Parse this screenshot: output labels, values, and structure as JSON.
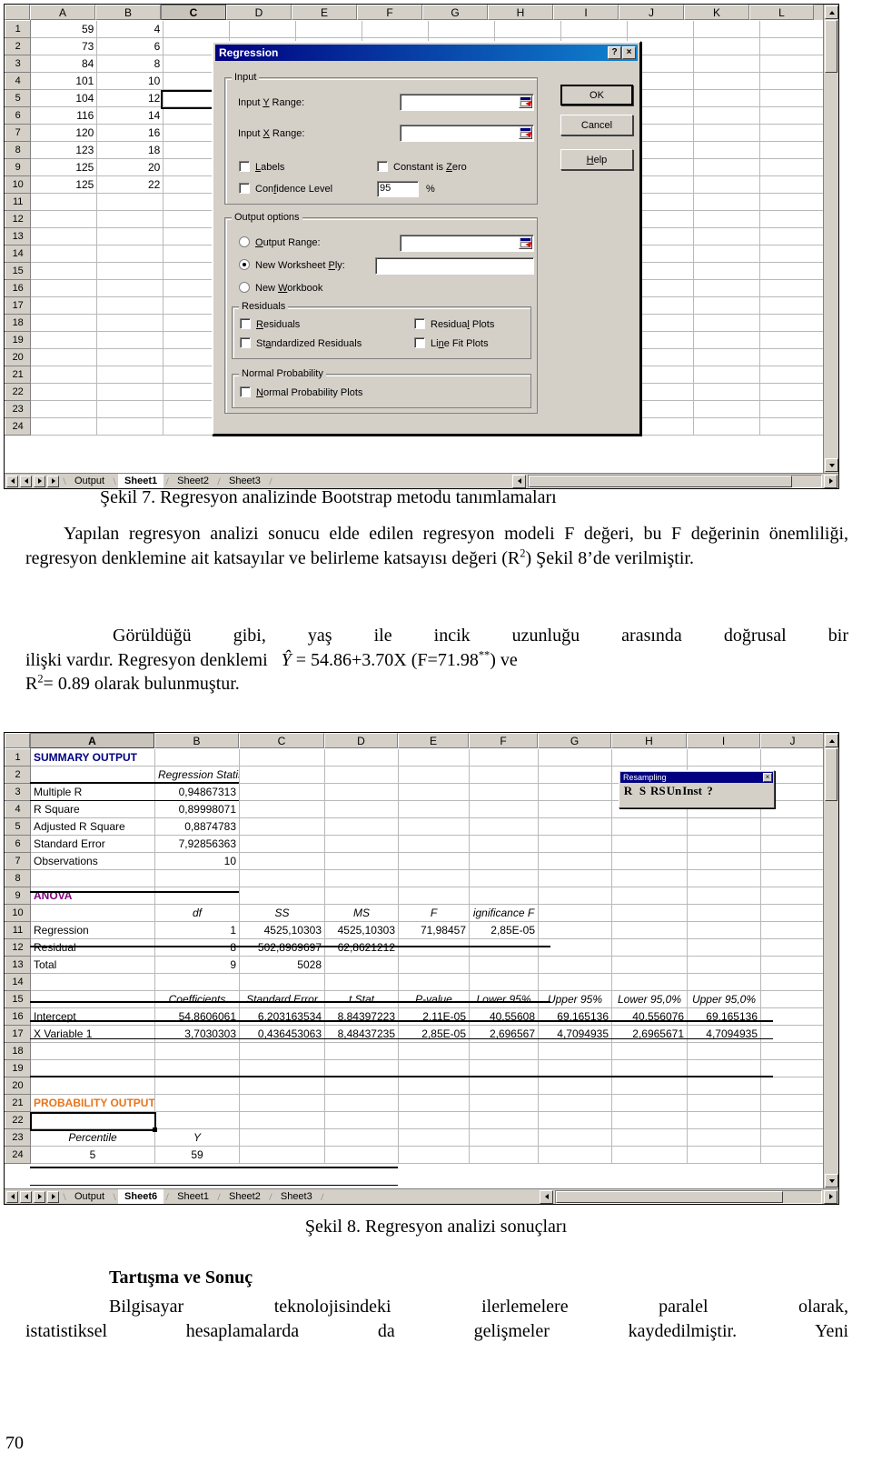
{
  "figure7": {
    "columns": [
      "A",
      "B",
      "C",
      "D",
      "E",
      "F",
      "G",
      "H",
      "I",
      "J",
      "K",
      "L"
    ],
    "selected_column": "C",
    "selected_cell_row": 5,
    "rows": [
      "1",
      "2",
      "3",
      "4",
      "5",
      "6",
      "7",
      "8",
      "9",
      "10",
      "11",
      "12",
      "13",
      "14",
      "15",
      "16",
      "17",
      "18",
      "19",
      "20",
      "21",
      "22",
      "23",
      "24"
    ],
    "data": [
      {
        "row": "1",
        "a": "59",
        "b": "4"
      },
      {
        "row": "2",
        "a": "73",
        "b": "6"
      },
      {
        "row": "3",
        "a": "84",
        "b": "8"
      },
      {
        "row": "4",
        "a": "101",
        "b": "10"
      },
      {
        "row": "5",
        "a": "104",
        "b": "12"
      },
      {
        "row": "6",
        "a": "116",
        "b": "14"
      },
      {
        "row": "7",
        "a": "120",
        "b": "16"
      },
      {
        "row": "8",
        "a": "123",
        "b": "18"
      },
      {
        "row": "9",
        "a": "125",
        "b": "20"
      },
      {
        "row": "10",
        "a": "125",
        "b": "22"
      }
    ],
    "tabs": [
      {
        "label": "Output",
        "active": false
      },
      {
        "label": "Sheet1",
        "active": true
      },
      {
        "label": "Sheet2",
        "active": false
      },
      {
        "label": "Sheet3",
        "active": false
      }
    ]
  },
  "dialog": {
    "title": "Regression",
    "help_button": "?",
    "close_button": "×",
    "input_group": "Input",
    "input_y_label": "Input Y Range:",
    "input_y_value": "",
    "input_x_label": "Input X Range:",
    "input_x_value": "",
    "labels_checkbox": "Labels",
    "constant_is_zero_checkbox": "Constant is Zero",
    "confidence_level_checkbox": "Confidence Level",
    "confidence_level_value": "95",
    "percent_sign": "%",
    "output_group": "Output options",
    "output_range_radio": "Output Range:",
    "output_range_value": "",
    "new_worksheet_ply_radio": "New Worksheet Ply:",
    "new_worksheet_ply_value": "",
    "new_workbook_radio": "New Workbook",
    "residuals_group": "Residuals",
    "residuals_checkbox": "Residuals",
    "residual_plots_checkbox": "Residual Plots",
    "standardized_residuals_checkbox": "Standardized Residuals",
    "line_fit_plots_checkbox": "Line Fit Plots",
    "normal_probability_group": "Normal Probability",
    "normal_probability_plots_checkbox": "Normal Probability Plots",
    "ok_button": "OK",
    "cancel_button": "Cancel",
    "help_label": "Help",
    "selected_output_option": "New Worksheet Ply:"
  },
  "caption7": "Şekil 7. Regresyon analizinde Bootstrap metodu tanımlamaları",
  "body_paragraph_1": "Yapılan regresyon analizi sonucu elde edilen regresyon modeli F değeri, bu F değerinin önemliliği, regresyon denklemine ait katsayılar ve belirleme katsayısı değeri (R",
  "body_paragraph_1_sup": "2",
  "body_paragraph_1_cont": ") Şekil 8’de verilmiştir.",
  "body_paragraph_2_a": "Görüldüğü gibi, yaş ile incik uzunluğu arasında doğrusal bir",
  "body_paragraph_2_b_pre": "ilişki vardır. Regresyon denklemi",
  "equation_yhat": "Ŷ",
  "equation_body": "= 54.86+3.70X   (F=71.98",
  "equation_sup": "**",
  "equation_tail": ") ve",
  "body_paragraph_2_c_pre": "R",
  "body_paragraph_2_c_sup": "2",
  "body_paragraph_2_c_post": "= 0.89 olarak bulunmuştur.",
  "figure8": {
    "columns": [
      "A",
      "B",
      "C",
      "D",
      "E",
      "F",
      "G",
      "H",
      "I",
      "J"
    ],
    "selected_column": "A",
    "selected_cell_row": 21,
    "summary_output_title": "SUMMARY OUTPUT",
    "regression_statistics_title": "Regression Statistics",
    "stats": [
      {
        "row": "3",
        "label": "Multiple R",
        "value": "0,94867313"
      },
      {
        "row": "4",
        "label": "R Square",
        "value": "0,89998071"
      },
      {
        "row": "5",
        "label": "Adjusted R Square",
        "value": "0,8874783"
      },
      {
        "row": "6",
        "label": "Standard Error",
        "value": "7,92856363"
      },
      {
        "row": "7",
        "label": "Observations",
        "value": "10"
      }
    ],
    "anova_title": "ANOVA",
    "anova_headers": [
      "",
      "df",
      "SS",
      "MS",
      "F",
      "ignificance F"
    ],
    "anova_rows": [
      {
        "row": "11",
        "label": "Regression",
        "df": "1",
        "ss": "4525,10303",
        "ms": "4525,10303",
        "f": "71,98457",
        "sig": "2,85E-05"
      },
      {
        "row": "12",
        "label": "Residual",
        "df": "8",
        "ss": "502,8969697",
        "ms": "62,8621212",
        "f": "",
        "sig": ""
      },
      {
        "row": "13",
        "label": "Total",
        "df": "9",
        "ss": "5028",
        "ms": "",
        "f": "",
        "sig": ""
      }
    ],
    "coef_headers": [
      "",
      "Coefficients",
      "Standard Error",
      "t Stat",
      "P-value",
      "Lower 95%",
      "Upper 95%",
      "Lower 95,0%",
      "Upper 95,0%"
    ],
    "coef_rows": [
      {
        "row": "16",
        "label": "Intercept",
        "coef": "54,8606061",
        "se": "6,203163534",
        "t": "8,84397223",
        "p": "2,11E-05",
        "l95": "40,55608",
        "u95": "69,165136",
        "l950": "40,556076",
        "u950": "69,165136"
      },
      {
        "row": "17",
        "label": "X Variable 1",
        "coef": "3,7030303",
        "se": "0,436453063",
        "t": "8,48437235",
        "p": "2,85E-05",
        "l95": "2,696567",
        "u95": "4,7094935",
        "l950": "2,6965671",
        "u950": "4,7094935"
      }
    ],
    "probability_output_title": "PROBABILITY OUTPUT",
    "percentile_header": "Percentile",
    "y_header": "Y",
    "percentile_row24": "5",
    "y_row24": "59",
    "rows": [
      "1",
      "2",
      "3",
      "4",
      "5",
      "6",
      "7",
      "8",
      "9",
      "10",
      "11",
      "12",
      "13",
      "14",
      "15",
      "16",
      "17",
      "18",
      "19",
      "20",
      "21",
      "22",
      "23",
      "24"
    ],
    "tabs": [
      {
        "label": "Output",
        "active": false
      },
      {
        "label": "Sheet6",
        "active": true
      },
      {
        "label": "Sheet1",
        "active": false
      },
      {
        "label": "Sheet2",
        "active": false
      },
      {
        "label": "Sheet3",
        "active": false
      }
    ],
    "colors": {
      "summary_output": "#000080",
      "anova": "#800080",
      "probability_output": "#e8741a"
    }
  },
  "resampling_toolbar": {
    "title": "Resampling",
    "close": "×",
    "buttons": [
      "R",
      "S",
      "RS",
      "Un",
      "Inst",
      "?"
    ]
  },
  "caption8": "Şekil 8. Regresyon analizi sonuçları",
  "section_heading": "Tartışma ve Sonuç",
  "body_paragraph_3_a": "Bilgisayar   teknolojisindeki   ilerlemelere   paralel   olarak,",
  "body_paragraph_3_b": "istatistiksel   hesaplamalarda   da   gelişmeler   kaydedilmiştir.   Yeni",
  "page_number": "70"
}
